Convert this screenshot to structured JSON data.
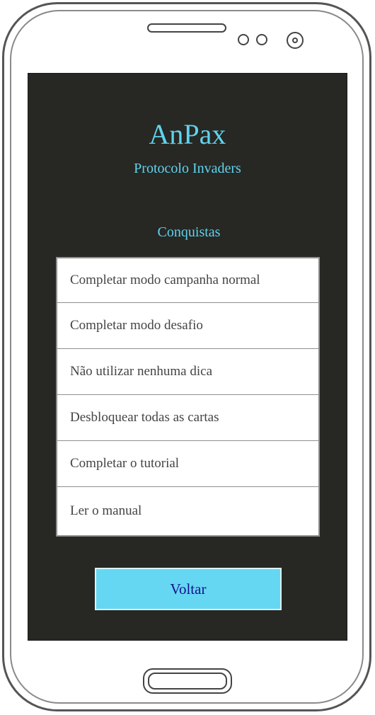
{
  "app": {
    "title": "AnPax",
    "subtitle": "Protocolo Invaders"
  },
  "achievements": {
    "heading": "Conquistas",
    "items": [
      "Completar modo campanha normal",
      "Completar modo desafio",
      "Não utilizar nenhuma dica",
      "Desbloquear todas as cartas",
      "Completar o tutorial",
      "Ler o manual"
    ]
  },
  "actions": {
    "back_label": "Voltar"
  },
  "colors": {
    "screen_background": "#272723",
    "accent_text": "#5fd4ee",
    "button_background": "#66d7f2",
    "button_text": "#121290"
  }
}
